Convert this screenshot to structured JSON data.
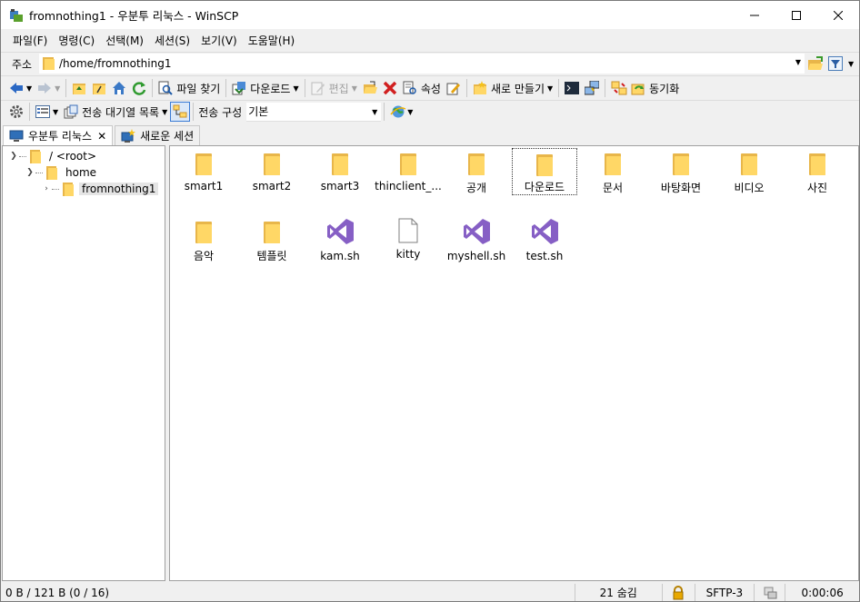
{
  "window": {
    "title": "fromnothing1 - 우분투 리눅스 - WinSCP",
    "minimize": "—",
    "maximize": "☐",
    "close": "✕"
  },
  "menu": [
    "파일(F)",
    "명령(C)",
    "선택(M)",
    "세션(S)",
    "보기(V)",
    "도움말(H)"
  ],
  "address": {
    "label": "주소",
    "path": "/home/fromnothing1"
  },
  "toolbar1": {
    "find": "파일 찾기",
    "download": "다운로드",
    "edit": "편집",
    "properties": "속성",
    "new": "새로 만들기",
    "sync": "동기화"
  },
  "toolbar2": {
    "queue": "전송 대기열 목록",
    "transfer_label": "전송 구성",
    "transfer_value": "기본"
  },
  "tabs": [
    {
      "label": "우분투 리눅스"
    },
    {
      "label": "새로운 세션"
    }
  ],
  "tree": [
    {
      "label": "/ <root>"
    },
    {
      "label": "home"
    },
    {
      "label": "fromnothing1"
    }
  ],
  "files": [
    {
      "name": "smart1",
      "type": "folder"
    },
    {
      "name": "smart2",
      "type": "folder"
    },
    {
      "name": "smart3",
      "type": "folder"
    },
    {
      "name": "thinclient_...",
      "type": "folder"
    },
    {
      "name": "공개",
      "type": "folder"
    },
    {
      "name": "다운로드",
      "type": "folder"
    },
    {
      "name": "문서",
      "type": "folder"
    },
    {
      "name": "바탕화면",
      "type": "folder"
    },
    {
      "name": "비디오",
      "type": "folder"
    },
    {
      "name": "사진",
      "type": "folder"
    },
    {
      "name": "음악",
      "type": "folder"
    },
    {
      "name": "템플릿",
      "type": "folder"
    },
    {
      "name": "kam.sh",
      "type": "vs"
    },
    {
      "name": "kitty",
      "type": "doc"
    },
    {
      "name": "myshell.sh",
      "type": "vs"
    },
    {
      "name": "test.sh",
      "type": "vs"
    }
  ],
  "status": {
    "size": "0 B / 121 B (0 / 16)",
    "hidden": "21 숨김",
    "protocol": "SFTP-3",
    "time": "0:00:06"
  },
  "colors": {
    "folder": "#ffd766",
    "vs_purple": "#865fc5",
    "accent": "#0063b1"
  }
}
